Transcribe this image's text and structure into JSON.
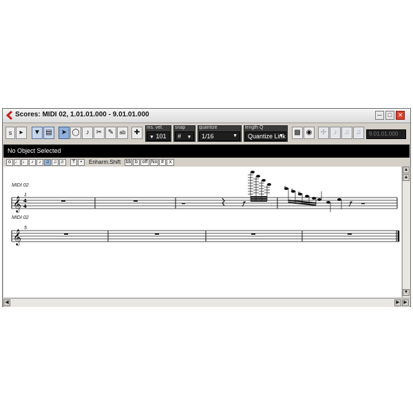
{
  "window": {
    "title": "Scores: MIDI 02, 1.01.01.000 - 9.01.01.000"
  },
  "toolbar": {
    "ins_vel_label": "ins. vel.",
    "ins_vel_value": "101",
    "snap_label": "snap",
    "quantize_label": "quantize",
    "quantize_value": "1/16",
    "length_q_label": "length Q",
    "length_q_value": "Quantize Link",
    "position_display": "9.01.01.000",
    "tools": [
      "select-tool-icon",
      "eraser-icon",
      "note-tool-icon",
      "scissors-icon",
      "glue-icon",
      "text-tool-icon"
    ]
  },
  "info_line": {
    "text": "No Object Selected"
  },
  "note_values_bar": {
    "enharm_label": "Enharm.Shift",
    "enharm_buttons": [
      "bb",
      "b",
      "off",
      "No",
      "#",
      "x"
    ]
  },
  "score": {
    "staff_label_1": "MIDI 02",
    "staff_label_2": "MIDI 02",
    "measure_num_1": "1",
    "measure_num_2": "5",
    "time_signature": "4/4",
    "clef": "treble"
  },
  "colors": {
    "window_bg": "#d4d0c8",
    "info_bar": "#000000",
    "selected_tool": "#8fb0dc",
    "close_button": "#d8412f"
  }
}
